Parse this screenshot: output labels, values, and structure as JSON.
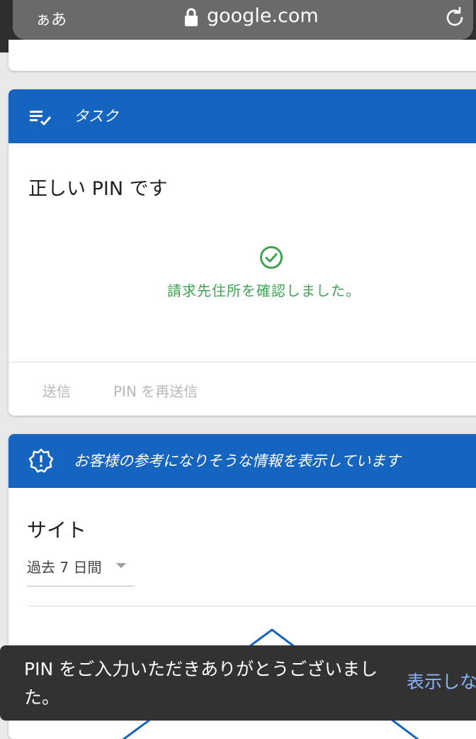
{
  "browser": {
    "text_size_label": "ぁあ",
    "domain": "google.com"
  },
  "task_card": {
    "header": "タスク",
    "title": "正しい PIN です",
    "confirm_message": "請求先住所を確認しました。",
    "send_button": "送信",
    "resend_button": "PIN を再送信"
  },
  "info_card": {
    "header": "お客様の参考になりそうな情報を表示しています",
    "section_title": "サイト",
    "range_select": "過去 7 日間"
  },
  "snackbar": {
    "message": "PIN をご入力いただきありがとうございました。",
    "action": "表示しな"
  },
  "colors": {
    "header_blue": "#1565c0",
    "success_green": "#3ea451",
    "snackbar_bg": "#323232",
    "snackbar_action": "#8ab4f8"
  }
}
